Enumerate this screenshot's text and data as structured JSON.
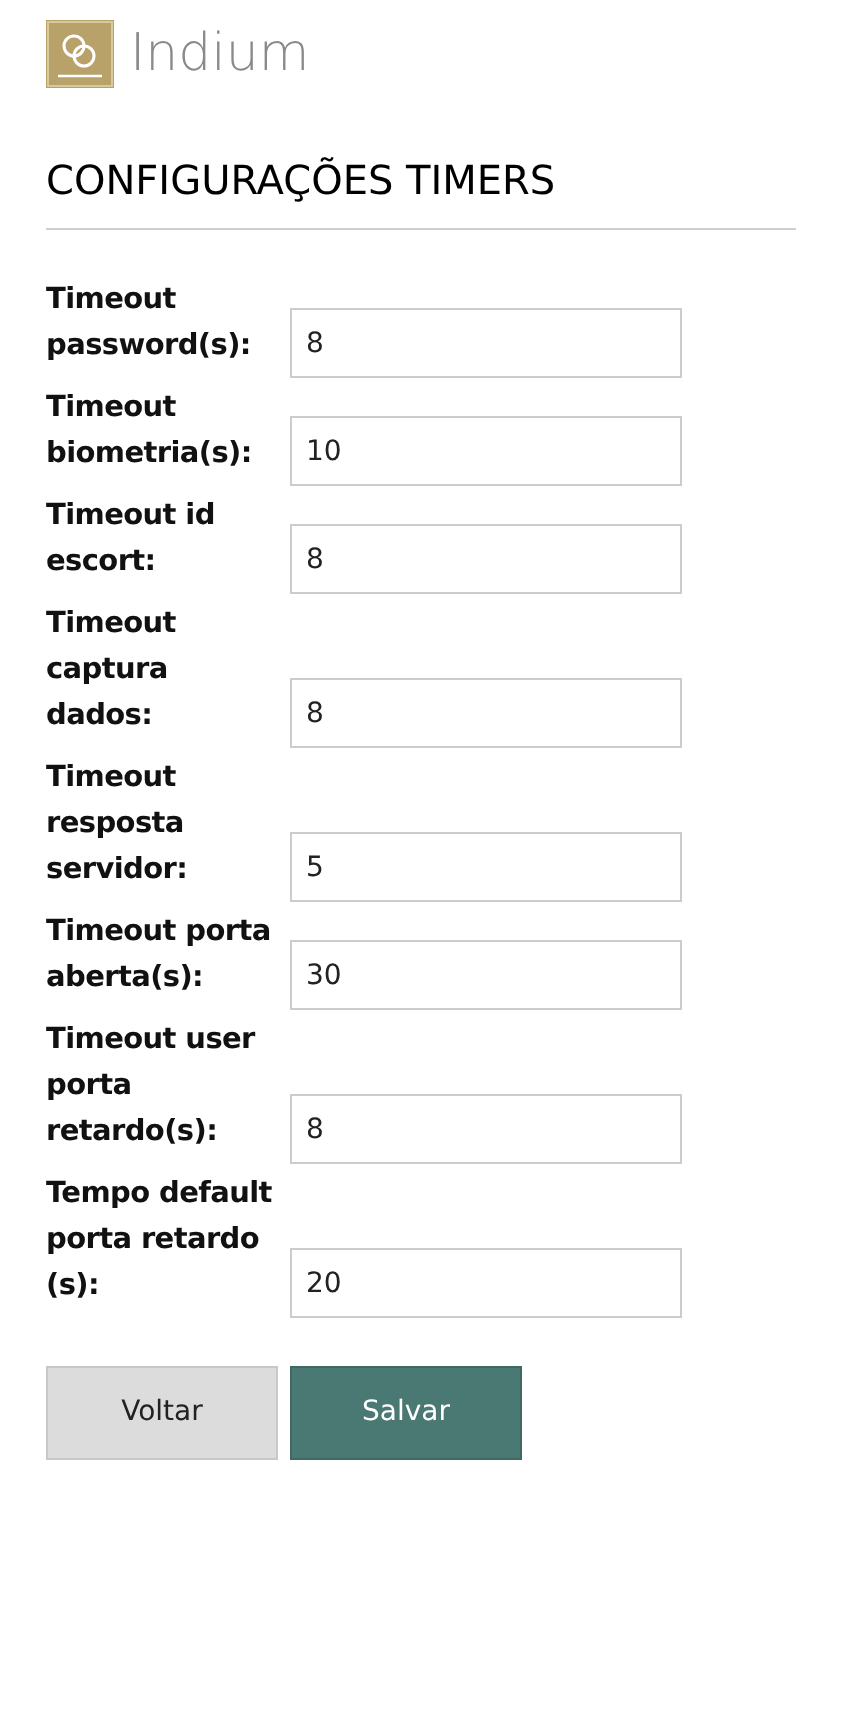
{
  "brand": {
    "name": "Indium"
  },
  "title": "CONFIGURAÇÕES TIMERS",
  "fields": [
    {
      "label": "Timeout password(s):",
      "value": "8"
    },
    {
      "label": "Timeout biometria(s):",
      "value": "10"
    },
    {
      "label": "Timeout id escort:",
      "value": "8"
    },
    {
      "label": "Timeout captura dados:",
      "value": "8"
    },
    {
      "label": "Timeout resposta servidor:",
      "value": "5"
    },
    {
      "label": "Timeout porta aberta(s):",
      "value": "30"
    },
    {
      "label": "Timeout user porta retardo(s):",
      "value": "8"
    },
    {
      "label": "Tempo default porta retardo (s):",
      "value": "20"
    }
  ],
  "buttons": [
    {
      "label": "Voltar",
      "kind": "secondary"
    },
    {
      "label": "Salvar",
      "kind": "primary"
    }
  ]
}
